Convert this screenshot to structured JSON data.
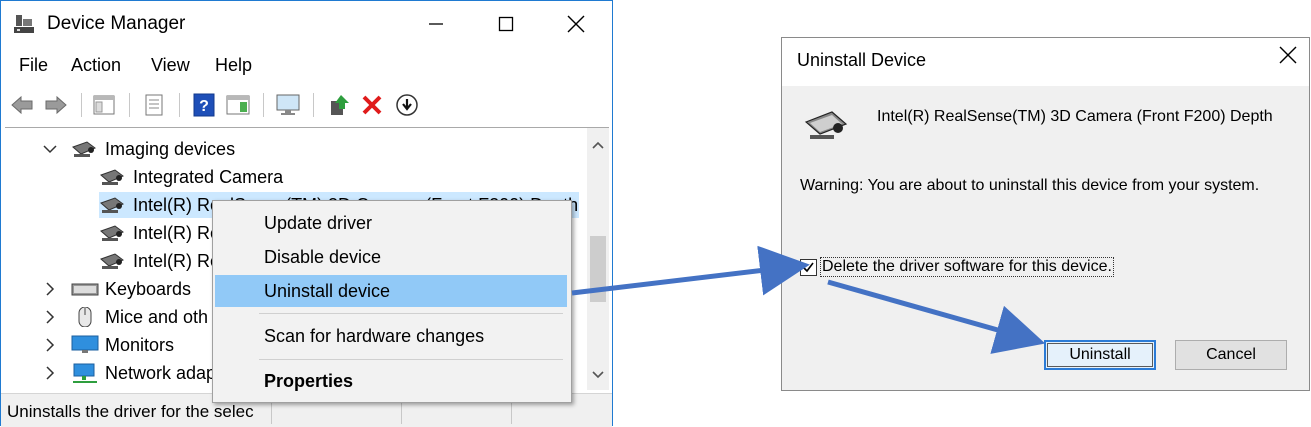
{
  "device_manager": {
    "title": "Device Manager",
    "menu": [
      "File",
      "Action",
      "View",
      "Help"
    ],
    "tree": {
      "category": "Imaging devices",
      "children": [
        "Integrated Camera",
        "Intel(R) RealSense(TM) 3D Camera (Front F200) Depth",
        "Intel(R) Re",
        "Intel(R) Re"
      ],
      "other_categories": [
        "Keyboards",
        "Mice and oth",
        "Monitors",
        "Network adap"
      ]
    },
    "status_text": "Uninstalls the driver for the selec"
  },
  "context_menu": {
    "items": [
      "Update driver",
      "Disable device",
      "Uninstall device",
      "Scan for hardware changes",
      "Properties"
    ],
    "selected": "Uninstall device"
  },
  "uninstall_dialog": {
    "title": "Uninstall Device",
    "device_name": "Intel(R) RealSense(TM) 3D Camera (Front F200) Depth",
    "warning": "Warning: You are about to uninstall this device from your system.",
    "checkbox_label": "Delete the driver software for this device.",
    "checkbox_checked": true,
    "uninstall_button": "Uninstall",
    "cancel_button": "Cancel"
  },
  "colors": {
    "accent": "#1f7ad1",
    "selection": "#91c9f7",
    "arrow": "#4472c4"
  }
}
